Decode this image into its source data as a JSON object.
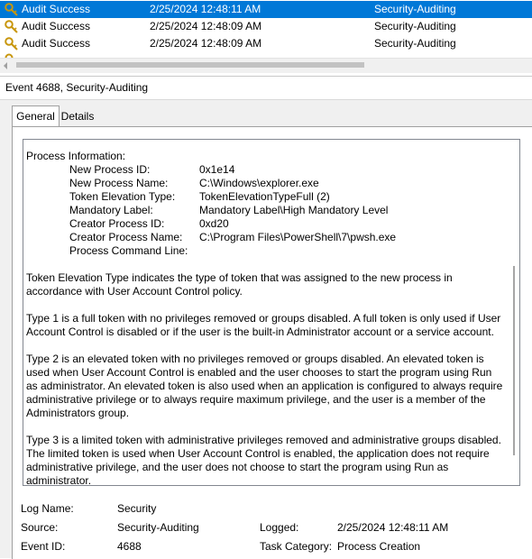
{
  "events": [
    {
      "level": "Audit Success",
      "datetime": "2/25/2024 12:48:11 AM",
      "source": "Security-Auditing",
      "selected": true
    },
    {
      "level": "Audit Success",
      "datetime": "2/25/2024 12:48:09 AM",
      "source": "Security-Auditing",
      "selected": false
    },
    {
      "level": "Audit Success",
      "datetime": "2/25/2024 12:48:09 AM",
      "source": "Security-Auditing",
      "selected": false
    }
  ],
  "event_header": "Event 4688, Security-Auditing",
  "tabs": {
    "general": "General",
    "details": "Details"
  },
  "process_info": {
    "title": "Process Information:",
    "fields": [
      {
        "label": "New Process ID:",
        "value": "0x1e14"
      },
      {
        "label": "New Process Name:",
        "value": "C:\\Windows\\explorer.exe"
      },
      {
        "label": "Token Elevation Type:",
        "value": "TokenElevationTypeFull (2)"
      },
      {
        "label": "Mandatory Label:",
        "value": "Mandatory Label\\High Mandatory Level"
      },
      {
        "label": "Creator Process ID:",
        "value": "0xd20"
      },
      {
        "label": "Creator Process Name:",
        "value": "C:\\Program Files\\PowerShell\\7\\pwsh.exe"
      },
      {
        "label": "Process Command Line:",
        "value": ""
      }
    ]
  },
  "paragraphs": {
    "p1": "Token Elevation Type indicates the type of token that was assigned to the new process in accordance with User Account Control policy.",
    "p2": "Type 1 is a full token with no privileges removed or groups disabled.  A full token is only used if User Account Control is disabled or if the user is the built-in Administrator account or a service account.",
    "p3": "Type 2 is an elevated token with no privileges removed or groups disabled.  An elevated token is used when User Account Control is enabled and the user chooses to start the program using Run as administrator.  An elevated token is also used when an application is configured to always require administrative privilege or to always require maximum privilege, and the user is a member of the Administrators group.",
    "p4": "Type 3 is a limited token with administrative privileges removed and administrative groups disabled.  The limited token is used when User Account Control is enabled, the application does not require administrative privilege, and the user does not choose to start the program using Run as administrator."
  },
  "summary": {
    "log_name_label": "Log Name:",
    "log_name": "Security",
    "source_label": "Source:",
    "source": "Security-Auditing",
    "logged_label": "Logged:",
    "logged": "2/25/2024 12:48:11 AM",
    "event_id_label": "Event ID:",
    "event_id": "4688",
    "task_category_label": "Task Category:",
    "task_category": "Process Creation"
  },
  "colors": {
    "selection": "#0078d7",
    "key_icon": "#d4a017"
  }
}
